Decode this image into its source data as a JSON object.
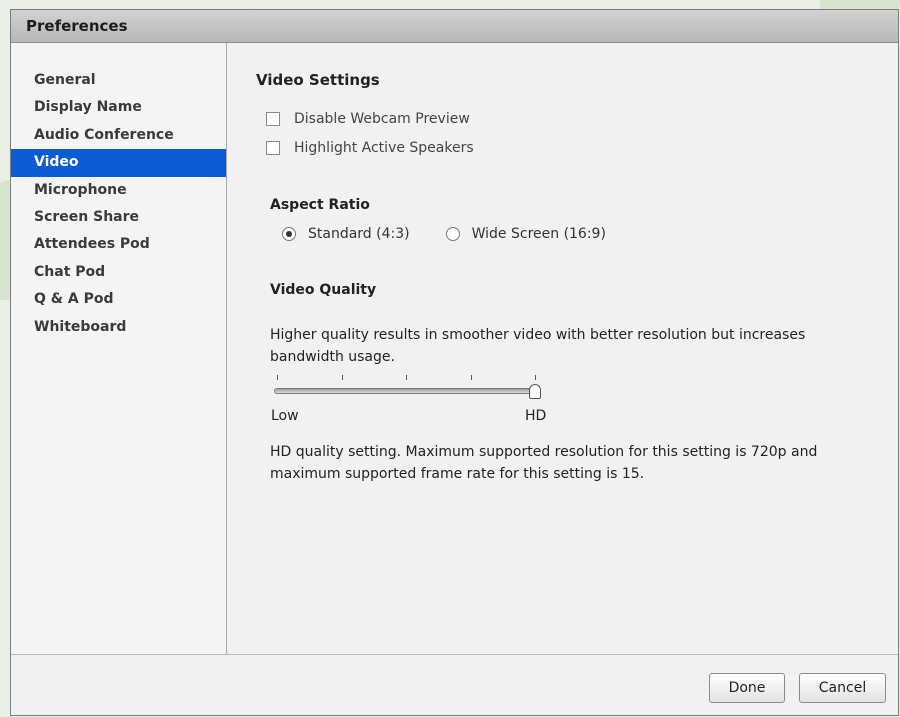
{
  "window": {
    "title": "Preferences"
  },
  "sidebar": {
    "items": [
      {
        "label": "General",
        "selected": false
      },
      {
        "label": "Display Name",
        "selected": false
      },
      {
        "label": "Audio Conference",
        "selected": false
      },
      {
        "label": "Video",
        "selected": true
      },
      {
        "label": "Microphone",
        "selected": false
      },
      {
        "label": "Screen Share",
        "selected": false
      },
      {
        "label": "Attendees Pod",
        "selected": false
      },
      {
        "label": "Chat Pod",
        "selected": false
      },
      {
        "label": "Q & A Pod",
        "selected": false
      },
      {
        "label": "Whiteboard",
        "selected": false
      }
    ]
  },
  "video_settings": {
    "heading": "Video Settings",
    "checkboxes": [
      {
        "label": "Disable Webcam Preview",
        "checked": false
      },
      {
        "label": "Highlight Active Speakers",
        "checked": false
      }
    ],
    "aspect_ratio": {
      "heading": "Aspect Ratio",
      "options": [
        {
          "label": "Standard (4:3)",
          "selected": true
        },
        {
          "label": "Wide Screen (16:9)",
          "selected": false
        }
      ]
    },
    "video_quality": {
      "heading": "Video Quality",
      "description": "Higher quality results in smoother video with better resolution but increases bandwidth usage.",
      "slider": {
        "min_label": "Low",
        "max_label": "HD",
        "steps": 5,
        "value_step": 5
      },
      "info": "HD quality setting. Maximum supported resolution for this setting is 720p and maximum supported frame rate for this setting is 15."
    }
  },
  "footer": {
    "done_label": "Done",
    "cancel_label": "Cancel"
  },
  "colors": {
    "selection": "#0b5cd2",
    "titlebar": "#c4c4c4",
    "background": "#f1f1f1"
  }
}
